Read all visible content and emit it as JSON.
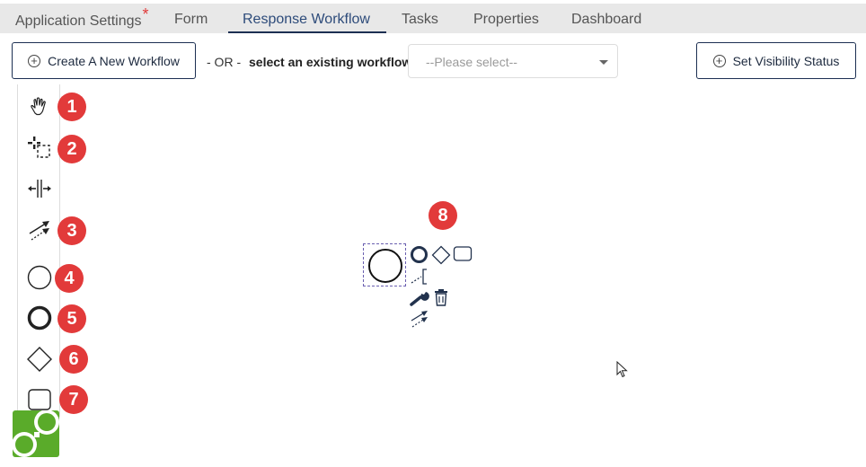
{
  "tabs": [
    {
      "label": "Application Settings",
      "required_marker": "*",
      "active": false
    },
    {
      "label": "Form",
      "active": false
    },
    {
      "label": "Response Workflow",
      "active": true
    },
    {
      "label": "Tasks",
      "active": false
    },
    {
      "label": "Properties",
      "active": false
    },
    {
      "label": "Dashboard",
      "active": false
    }
  ],
  "toolbar": {
    "create_label": "Create A New Workflow",
    "or_label": "- OR -",
    "select_label": "select an existing workflow:",
    "select_placeholder": "--Please select--",
    "visibility_label": "Set Visibility Status"
  },
  "palette": {
    "tools": [
      {
        "name": "hand-tool",
        "icon": "hand-icon",
        "badge": "1"
      },
      {
        "name": "lasso-tool",
        "icon": "lasso-icon",
        "badge": "2"
      },
      {
        "name": "space-tool",
        "icon": "space-icon",
        "badge": ""
      },
      {
        "name": "connect-tool",
        "icon": "connect-icon",
        "badge": "3"
      },
      {
        "name": "start-event-tool",
        "icon": "start-event-icon",
        "badge": "4"
      },
      {
        "name": "end-event-tool",
        "icon": "end-event-icon",
        "badge": "5"
      },
      {
        "name": "gateway-tool",
        "icon": "gateway-icon",
        "badge": "6"
      },
      {
        "name": "task-tool",
        "icon": "task-icon",
        "badge": "7"
      }
    ]
  },
  "context_pad": {
    "badge": "8",
    "items": [
      "end-event-icon",
      "gateway-icon",
      "task-icon",
      "annotation-icon",
      "wrench-icon",
      "trash-icon",
      "connect-icon"
    ]
  },
  "colors": {
    "badge": "#e23a3a",
    "active_tab": "#1c2f52",
    "logo": "#5aab2a",
    "selection": "#6a5fb0"
  }
}
